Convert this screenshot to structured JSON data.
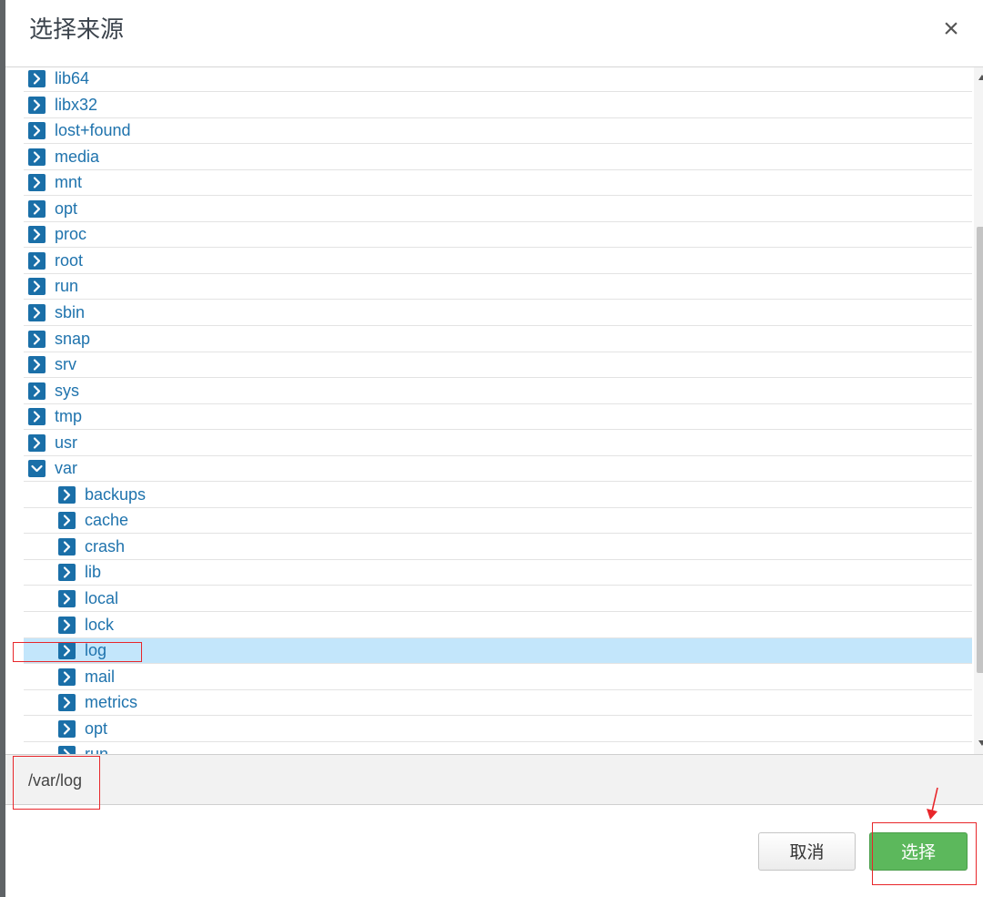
{
  "dialog": {
    "title": "选择来源",
    "close_icon": "close-icon",
    "close_glyph": "×"
  },
  "tree": {
    "root_items": [
      {
        "label": "lib64",
        "expanded": false
      },
      {
        "label": "libx32",
        "expanded": false
      },
      {
        "label": "lost+found",
        "expanded": false
      },
      {
        "label": "media",
        "expanded": false
      },
      {
        "label": "mnt",
        "expanded": false
      },
      {
        "label": "opt",
        "expanded": false
      },
      {
        "label": "proc",
        "expanded": false
      },
      {
        "label": "root",
        "expanded": false
      },
      {
        "label": "run",
        "expanded": false
      },
      {
        "label": "sbin",
        "expanded": false
      },
      {
        "label": "snap",
        "expanded": false
      },
      {
        "label": "srv",
        "expanded": false
      },
      {
        "label": "sys",
        "expanded": false
      },
      {
        "label": "tmp",
        "expanded": false
      },
      {
        "label": "usr",
        "expanded": false
      },
      {
        "label": "var",
        "expanded": true
      }
    ],
    "var_children": [
      {
        "label": "backups",
        "selected": false
      },
      {
        "label": "cache",
        "selected": false
      },
      {
        "label": "crash",
        "selected": false
      },
      {
        "label": "lib",
        "selected": false
      },
      {
        "label": "local",
        "selected": false
      },
      {
        "label": "lock",
        "selected": false
      },
      {
        "label": "log",
        "selected": true
      },
      {
        "label": "mail",
        "selected": false
      },
      {
        "label": "metrics",
        "selected": false
      },
      {
        "label": "opt",
        "selected": false
      },
      {
        "label": "run",
        "selected": false
      }
    ]
  },
  "selected_path": "/var/log",
  "footer": {
    "cancel_label": "取消",
    "select_label": "选择"
  },
  "colors": {
    "accent_blue": "#1a6fa8",
    "selected_row": "#c3e6fb",
    "select_button": "#5cb85c",
    "annotation_red": "#e8262a"
  }
}
